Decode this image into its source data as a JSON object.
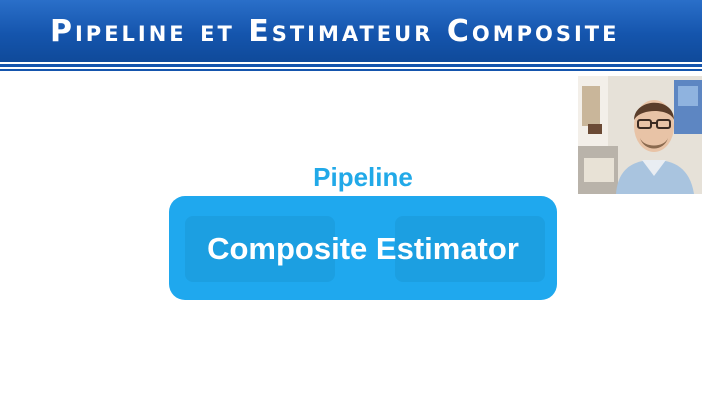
{
  "slide": {
    "title": "Pipeline et Estimateur Composite",
    "pipeline_label": "Pipeline",
    "composite_estimator_label": "Composite Estimator"
  },
  "colors": {
    "header_blue": "#1555ad",
    "accent_cyan": "#21a9e8",
    "box_blue": "#1fa8ee"
  },
  "webcam": {
    "icon": "presenter-video"
  }
}
